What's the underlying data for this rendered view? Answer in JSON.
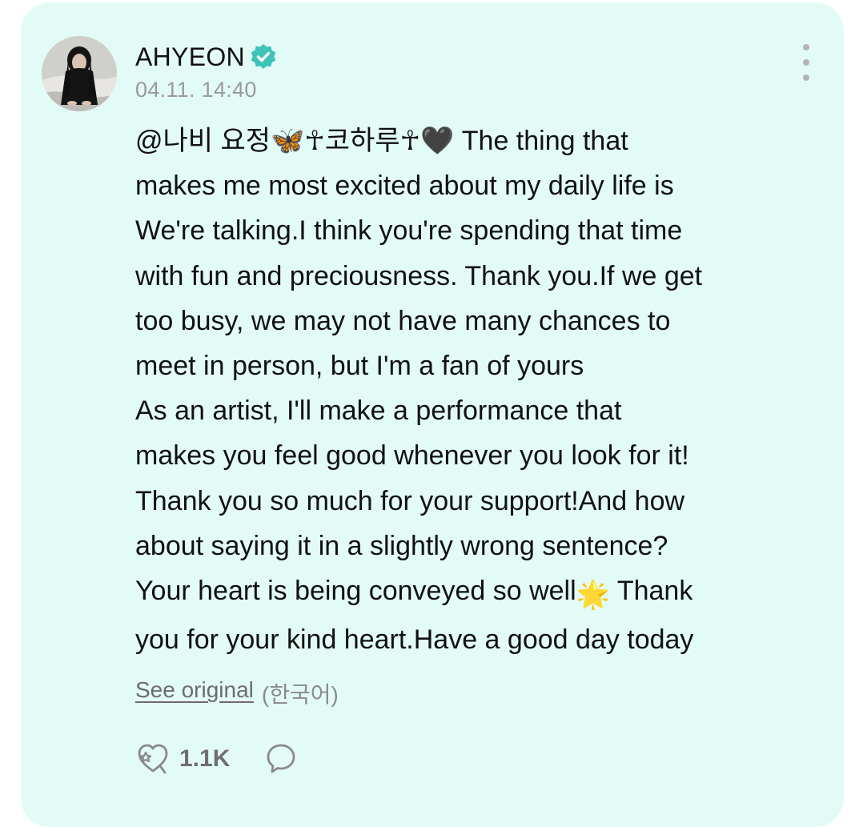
{
  "post": {
    "author": "AHYEON",
    "timestamp": "04.11. 14:40",
    "verified_icon": "verified-badge-icon",
    "more_icon": "more-vertical-icon",
    "mention": "@나비 요정🦋☥코하루☥🖤",
    "lines": [
      " The thing that",
      "makes me most excited about my daily life is",
      "We're talking.I think you're spending that time",
      "with fun and preciousness. Thank you.If we get",
      "too busy, we may not have many chances to",
      "meet in person, but I'm a fan of yours",
      "As an artist, I'll make a performance that",
      "makes you feel good whenever you look for it!",
      "Thank you so much for your support!And how",
      "about saying it in a slightly wrong sentence?",
      "Your heart is being conveyed so well",
      " Thank",
      "you for your kind heart.Have a good day today"
    ],
    "sparkle_emoji": "🌟",
    "see_original": "See original",
    "original_language": "(한국어)",
    "like_count": "1.1K",
    "like_icon": "like-heart-icon",
    "comment_icon": "comment-bubble-icon",
    "accent_color": "#3fc3b8",
    "card_color": "#e3fbf6"
  }
}
